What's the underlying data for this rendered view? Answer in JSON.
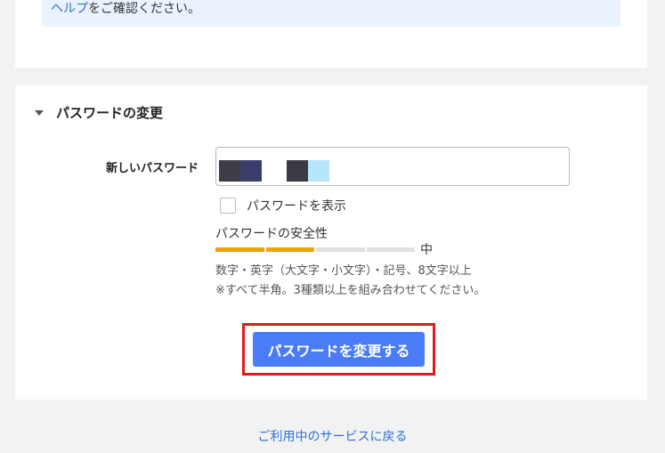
{
  "notice": {
    "link_text": "ヘルプ",
    "text": "をご確認ください。"
  },
  "password_section": {
    "title": "パスワードの変更",
    "new_password_label": "新しいパスワード",
    "show_password_label": "パスワードを表示",
    "show_password_checked": false,
    "strength_label": "パスワードの安全性",
    "strength_level": "中",
    "strength_fraction": 0.5,
    "hint_line1": "数字・英字（大文字・小文字）・記号、8文字以上",
    "hint_line2": "※すべて半角。3種類以上を組み合わせてください。",
    "submit_label": "パスワードを変更する"
  },
  "footer": {
    "back_link": "ご利用中のサービスに戻る"
  },
  "colors": {
    "accent_button": "#4a7cf6",
    "highlight_border": "#e11a1f",
    "strength_on": "#f0a30a",
    "link": "#2f6fd6"
  }
}
